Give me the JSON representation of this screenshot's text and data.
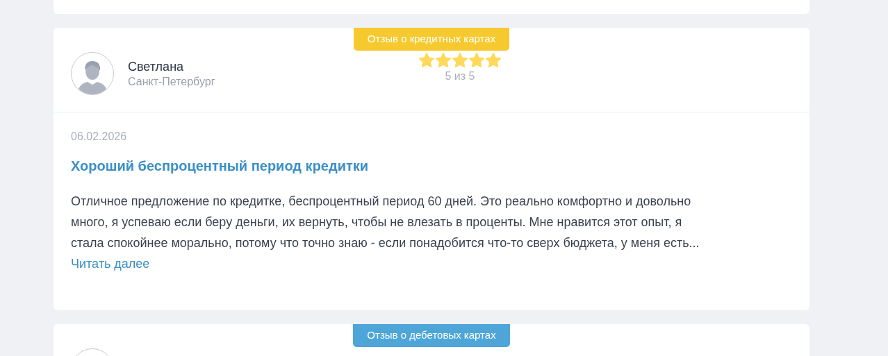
{
  "reviews": [
    {
      "badge": {
        "text": "Отзыв о кредитных картах",
        "kind": "credit"
      },
      "author": {
        "name": "Светлана",
        "city": "Санкт-Петербург"
      },
      "stars": 5,
      "rating_text": "5 из 5",
      "date": "06.02.2026",
      "title": "Хороший беспроцентный период кредитки",
      "text": "Отличное предложение по кредитке, беспроцентный период 60 дней. Это реально комфортно и довольно много, я успеваю если беру деньги, их вернуть, чтобы не влезать в проценты. Мне нравится этот опыт, я стала спокойнее морально, потому что точно знаю - если понадобится что-то сверх бюджета, у меня есть...",
      "read_more": "Читать далее"
    },
    {
      "badge": {
        "text": "Отзыв о дебетовых картах",
        "kind": "debit"
      }
    }
  ]
}
